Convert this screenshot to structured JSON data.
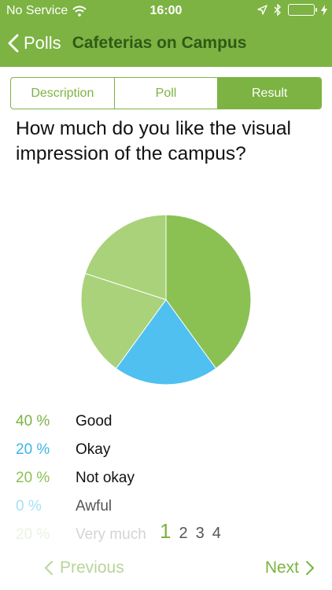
{
  "status_bar": {
    "carrier": "No Service",
    "time": "16:00"
  },
  "nav": {
    "back_label": "Polls",
    "title": "Cafeterias on Campus"
  },
  "tabs": [
    {
      "label": "Description",
      "active": false
    },
    {
      "label": "Poll",
      "active": false
    },
    {
      "label": "Result",
      "active": true
    }
  ],
  "question": "How much do you like the visual impression of the campus?",
  "chart_data": {
    "type": "pie",
    "categories": [
      "Good",
      "Okay",
      "Not okay",
      "Awful",
      "Very much"
    ],
    "values": [
      40,
      20,
      20,
      0,
      20
    ],
    "colors": [
      "#8bc152",
      "#4fc0f0",
      "#a9d27b",
      "#bce7fb",
      "#a9d27b"
    ]
  },
  "results": [
    {
      "percent": "40 %",
      "label": "Good",
      "color": "#7cb342"
    },
    {
      "percent": "20 %",
      "label": "Okay",
      "color": "#3fb4e8"
    },
    {
      "percent": "20 %",
      "label": "Not okay",
      "color": "#8bc152"
    },
    {
      "percent": "0 %",
      "label": "Awful",
      "color": "#4fc0f0"
    },
    {
      "percent": "20 %",
      "label": "Very much",
      "color": "#8bc152"
    }
  ],
  "pager": {
    "pages": [
      "1",
      "2",
      "3",
      "4"
    ],
    "current": "1"
  },
  "footer": {
    "previous_label": "Previous",
    "next_label": "Next"
  }
}
